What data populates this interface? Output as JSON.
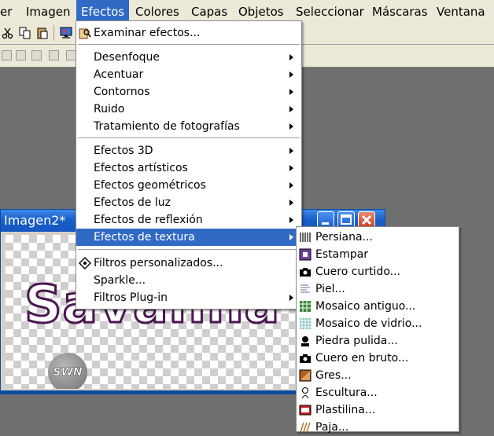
{
  "menubar": {
    "items": [
      {
        "label": "er"
      },
      {
        "label": "Imagen"
      },
      {
        "label": "Efectos"
      },
      {
        "label": "Colores"
      },
      {
        "label": "Capas"
      },
      {
        "label": "Objetos"
      },
      {
        "label": "Seleccionar"
      },
      {
        "label": "Máscaras"
      },
      {
        "label": "Ventana"
      }
    ]
  },
  "document": {
    "title": "Imagen2*",
    "canvas_text": "Savanna",
    "logo_text": "SWN"
  },
  "effects_menu": {
    "top_item": "Examinar efectos...",
    "groups": [
      [
        "Desenfoque",
        "Acentuar",
        "Contornos",
        "Ruido",
        "Tratamiento de fotografías"
      ],
      [
        "Efectos 3D",
        "Efectos artísticos",
        "Efectos geométricos",
        "Efectos de luz",
        "Efectos de reflexión",
        "Efectos de textura"
      ],
      [
        "Filtros personalizados...",
        "Sparkle...",
        "Filtros Plug-in"
      ]
    ],
    "highlighted": "Efectos de textura"
  },
  "texture_submenu": {
    "items": [
      "Persiana...",
      "Estampar",
      "Cuero curtido...",
      "Piel...",
      "Mosaico antiguo...",
      "Mosaico de vidrio...",
      "Piedra pulida...",
      "Cuero en bruto...",
      "Gres...",
      "Escultura...",
      "Plastilina...",
      "Paja..."
    ]
  },
  "colors": {
    "highlight": "#316ac5",
    "titlebar": "#1b5fc9",
    "menubar": "#ece9d8",
    "workspace": "#6f6f6f",
    "text_outline": "#4a1650"
  },
  "icons": {
    "toolbar": [
      "scissors-icon",
      "copy-icon",
      "paste-icon",
      "monitor-icon",
      "browse-effects-icon"
    ],
    "submenu": [
      "blinds-icon",
      "emboss-icon",
      "camera-icon",
      "fur-icon",
      "mosaic-icon",
      "glass-mosaic-icon",
      "stone-icon",
      "camera-icon",
      "sandstone-icon",
      "sculpture-icon",
      "plasticine-icon",
      "straw-icon"
    ]
  }
}
